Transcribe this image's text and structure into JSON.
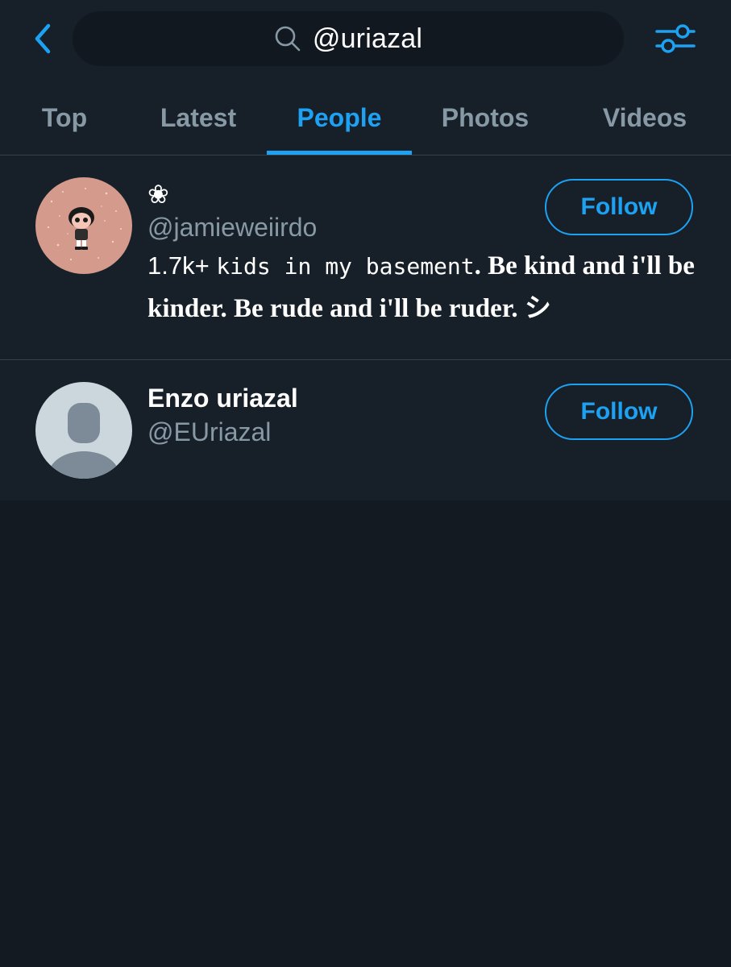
{
  "search": {
    "query": "@uriazal"
  },
  "tabs": [
    {
      "label": "Top"
    },
    {
      "label": "Latest"
    },
    {
      "label": "People"
    },
    {
      "label": "Photos"
    },
    {
      "label": "Videos"
    }
  ],
  "active_tab": "People",
  "results": [
    {
      "name": "❀",
      "handle": "@jamieweiirdo",
      "bio_part1": "1.7k+",
      "bio_part2": "kids in my basement",
      "bio_part3": ". Be kind and i'll be kinder. Be rude and i'll be ruder. シ",
      "follow_label": "Follow"
    },
    {
      "name": "Enzo uriazal",
      "handle": "@EUriazal",
      "follow_label": "Follow"
    }
  ],
  "colors": {
    "accent": "#1da1f2",
    "background": "#131a21",
    "surface": "#172029",
    "secondary_text": "#8899a6",
    "divider": "#38444d",
    "avatar1_bg": "#d49a8c",
    "default_avatar_bg": "#ccd6dd",
    "default_avatar_fg": "#7d8b98"
  },
  "icons": {
    "back": "chevron-left-icon",
    "search": "search-icon",
    "filter": "sliders-icon"
  }
}
